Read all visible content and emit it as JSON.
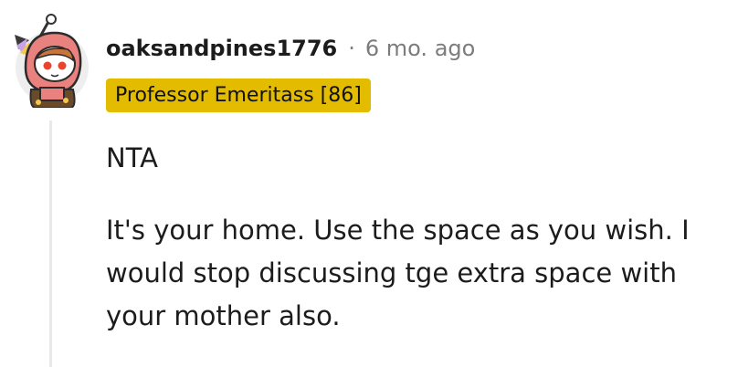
{
  "comment": {
    "author": "oaksandpines1776",
    "separator": "·",
    "timestamp": "6 mo. ago",
    "flair": "Professor Emeritass [86]",
    "paragraphs": [
      "NTA",
      "It's your home. Use the space as you wish. I would stop discussing tge extra space with your mother also."
    ]
  },
  "colors": {
    "flair_bg": "#e3bc00",
    "meta_text": "#7c7c7c",
    "thread_line": "#e9e9e9",
    "avatar_hood": "#e9817e",
    "avatar_bg": "#eeeeee"
  },
  "icons": {
    "avatar": "snoo-avatar-pink-hood"
  }
}
